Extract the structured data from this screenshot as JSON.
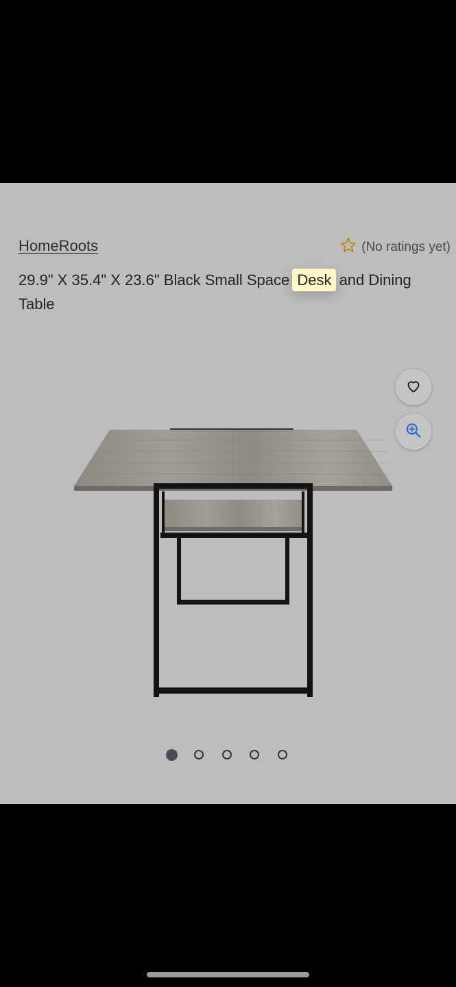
{
  "product": {
    "brand": "HomeRoots",
    "rating_text": "(No ratings yet)",
    "title_before": "29.9\" X 35.4\" X 23.6\" Black Small Space ",
    "title_highlight": "Desk",
    "title_after": " and Dining Table"
  },
  "actions": {
    "favorite_icon": "heart-outline-icon",
    "zoom_icon": "zoom-in-icon"
  },
  "carousel": {
    "total_images": 5,
    "active_index": 0
  },
  "colors": {
    "accent_blue": "#2f6bd6",
    "star_gold": "#b8860b",
    "highlight": "#fff6c9"
  }
}
